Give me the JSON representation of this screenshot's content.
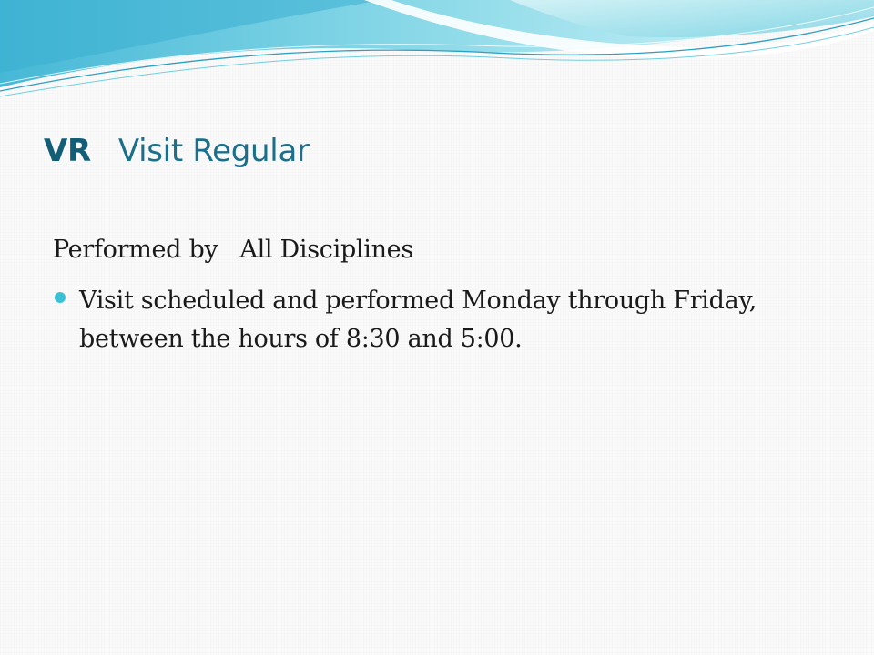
{
  "slide": {
    "title_abbr": "VR",
    "title_text": "Visit Regular",
    "performed_label": "Performed by",
    "performed_value": "All Disciplines",
    "bullets": [
      "Visit scheduled and performed Monday through Friday, between the hours of 8:30 and 5:00."
    ]
  },
  "theme": {
    "title_color": "#1b6f8a",
    "accent_color": "#3cc0d6",
    "banner_light": "#c7eef3",
    "banner_mid": "#6fcfe0",
    "banner_dark": "#2a9fc4"
  }
}
